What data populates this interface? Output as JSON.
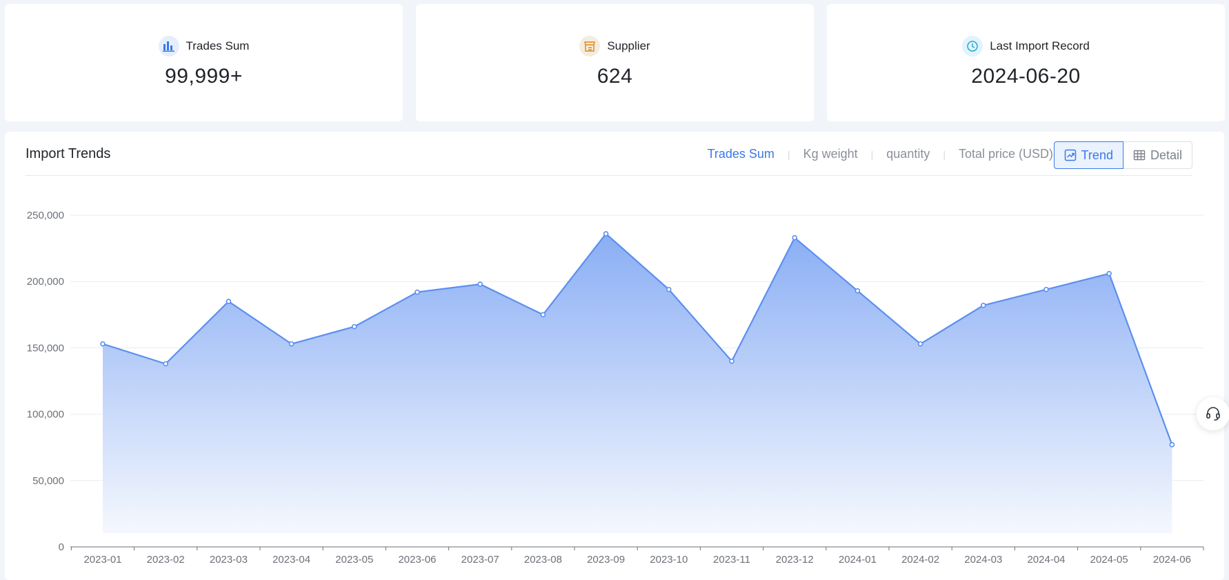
{
  "stats": [
    {
      "label": "Trades Sum",
      "value": "99,999+",
      "icon": "bar-chart-icon",
      "color": "#3a78e8",
      "bg": "#e6eefc"
    },
    {
      "label": "Supplier",
      "value": "624",
      "icon": "store-icon",
      "color": "#e0891b",
      "bg": "#f5ece0"
    },
    {
      "label": "Last Import Record",
      "value": "2024-06-20",
      "icon": "clock-icon",
      "color": "#23a8d8",
      "bg": "#e2f3f9"
    }
  ],
  "panel": {
    "title": "Import Trends",
    "tabs": [
      "Trades Sum",
      "Kg weight",
      "quantity",
      "Total price (USD)"
    ],
    "active_tab": "Trades Sum",
    "views": {
      "trend": "Trend",
      "detail": "Detail"
    }
  },
  "chart_data": {
    "type": "area",
    "x": [
      "2023-01",
      "2023-02",
      "2023-03",
      "2023-04",
      "2023-05",
      "2023-06",
      "2023-07",
      "2023-08",
      "2023-09",
      "2023-10",
      "2023-11",
      "2023-12",
      "2024-01",
      "2024-02",
      "2024-03",
      "2024-04",
      "2024-05",
      "2024-06"
    ],
    "series": [
      {
        "values": [
          153000,
          138000,
          185000,
          153000,
          166000,
          192000,
          198000,
          175000,
          236000,
          194000,
          140000,
          233000,
          193000,
          153000,
          182000,
          194000,
          206000,
          77000
        ]
      }
    ],
    "yticks": [
      "0",
      "50,000",
      "100,000",
      "150,000",
      "200,000",
      "250,000"
    ],
    "ylim": [
      0,
      250000
    ],
    "grid": true,
    "colors": {
      "line": "#5b8ff0",
      "fill_top": "#8aaef4",
      "fill_bottom": "#f5f8fe",
      "grid": "#e8ebf0",
      "tick_text": "#6b7079"
    }
  },
  "support_icon": "headset-icon"
}
